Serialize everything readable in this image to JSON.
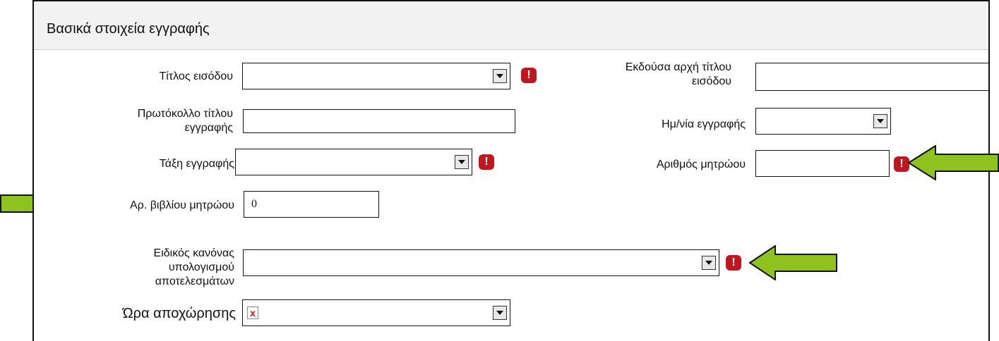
{
  "panel": {
    "title": "Βασικά στοιχεία εγγραφής"
  },
  "fields": {
    "entry_title": {
      "label": "Τίτλος εισόδου",
      "value": ""
    },
    "issuing_authority": {
      "label": "Εκδούσα αρχή τίτλου εισόδου",
      "value": ""
    },
    "entry_title_protocol": {
      "label": "Πρωτόκολλο τίτλου εγγραφής",
      "value": ""
    },
    "registration_date": {
      "label": "Ημ/νία εγγραφής",
      "value": ""
    },
    "registration_class": {
      "label": "Τάξη εγγραφής",
      "value": ""
    },
    "registry_number": {
      "label": "Αριθμός μητρώου",
      "value": ""
    },
    "registry_book_number": {
      "label": "Αρ. βιβλίου μητρώου",
      "value": "0"
    },
    "special_calc_rule": {
      "label": "Ειδικός κανόνας υπολογισμού αποτελεσμάτων",
      "value": ""
    },
    "withdrawal_time": {
      "label": "Ώρα αποχώρησης",
      "value": "x"
    }
  },
  "error_icon": "!",
  "colors": {
    "arrow_fill": "#8dc21f",
    "arrow_stroke": "#111111",
    "error": "#c0161e"
  }
}
